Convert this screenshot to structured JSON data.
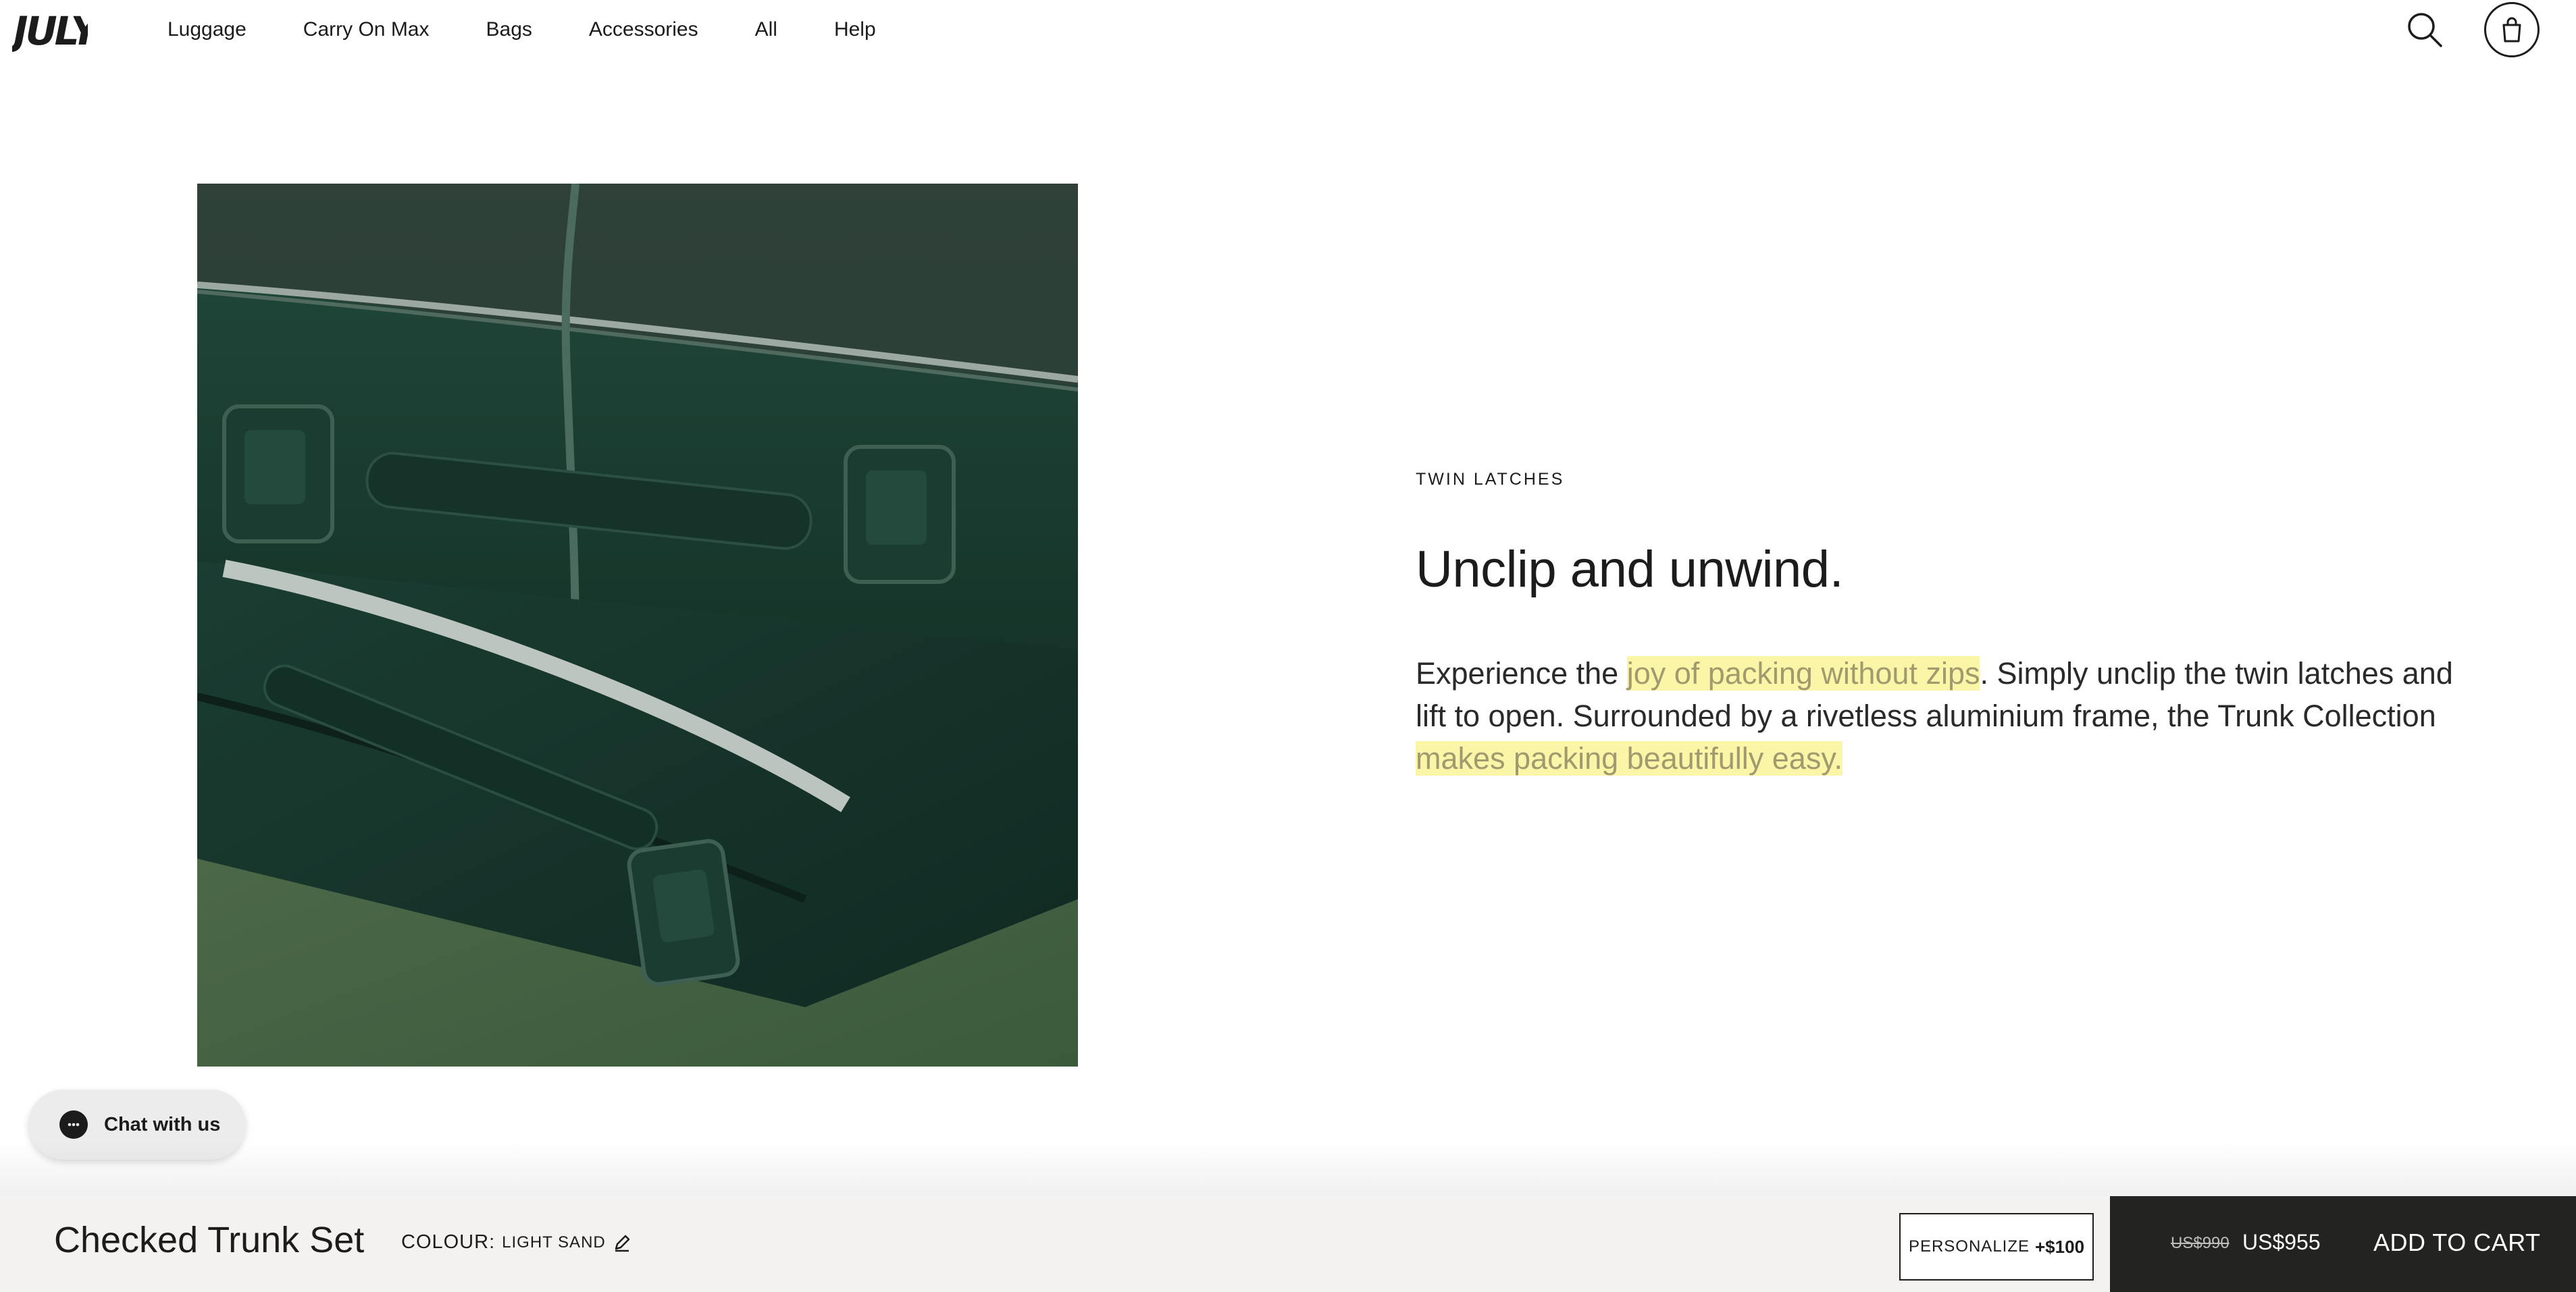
{
  "brand": {
    "logo_text": "JULY"
  },
  "nav": {
    "items": [
      {
        "label": "Luggage"
      },
      {
        "label": "Carry On Max"
      },
      {
        "label": "Bags"
      },
      {
        "label": "Accessories"
      },
      {
        "label": "All"
      },
      {
        "label": "Help"
      }
    ]
  },
  "header_icons": {
    "search": "search-icon",
    "cart": "shopping-bag-icon"
  },
  "feature": {
    "eyebrow": "TWIN LATCHES",
    "headline": "Unclip and unwind.",
    "body": {
      "part1": "Experience the ",
      "highlight1": "joy of packing without zips",
      "part2": ". Simply unclip the twin latches and lift to open. Surrounded by a rivetless aluminium frame, the Trunk Collection ",
      "highlight2": "makes packing beautifully easy."
    },
    "image_alt": "Two dark green trunk suitcases with twin latches on a green carpet"
  },
  "chat": {
    "label": "Chat with us"
  },
  "sticky_bar": {
    "product_name": "Checked Trunk Set",
    "colour_label": "COLOUR:",
    "colour_value": "LIGHT SAND",
    "personalize_label": "PERSONALIZE",
    "personalize_price": "+$100",
    "price_old": "US$990",
    "price_new": "US$955",
    "add_to_cart": "ADD TO CART"
  },
  "colors": {
    "highlight": "#fbf5a8",
    "cart_panel": "#232321",
    "bar": "#f3f2f0"
  }
}
